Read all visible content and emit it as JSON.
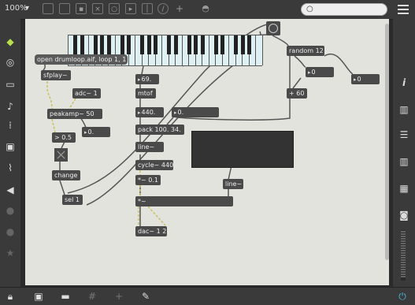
{
  "toolbar": {
    "zoom": "100%",
    "search_placeholder": ""
  },
  "objects": {
    "open_msg": "open drumloop.aif, loop 1, 1",
    "sfplay": "sfplay~",
    "adc": "adc~ 1",
    "peakamp": "peakamp~ 50",
    "gt": "> 0.5",
    "num_peak": "0.",
    "change": "change",
    "sel": "sel 1",
    "num69": "69.",
    "mtof": "mtof",
    "num440": "440.",
    "num0b": "0.",
    "pack": "pack 100. 34.",
    "line1": "line~",
    "cycle": "cycle~ 440",
    "times": "*~ 0.1",
    "times2": "*~",
    "dac": "dac~ 1 2",
    "random": "random 12",
    "num_rand": "0",
    "plus60": "+ 60",
    "num_right": "0",
    "line2": "line~"
  },
  "colors": {
    "canvas": "#e3e3de",
    "object": "#4a4a4a",
    "patch_cord": "#555555",
    "signal_cord": "#c8c060"
  }
}
